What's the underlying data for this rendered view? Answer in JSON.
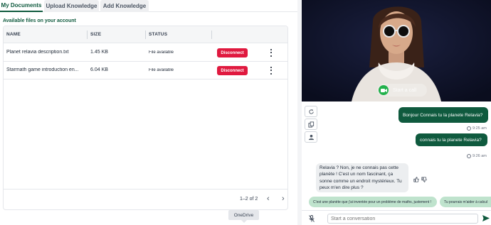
{
  "tabs": [
    {
      "label": "My Documents",
      "active": true
    },
    {
      "label": "Upload Knowledge",
      "active": false
    },
    {
      "label": "Add Knowledge",
      "active": false
    }
  ],
  "section_title": "Available files on your account",
  "table": {
    "columns": [
      "NAME",
      "SIZE",
      "STATUS"
    ],
    "rows": [
      {
        "name": "Planet relavia description.txt",
        "size": "1.45 KB",
        "status": "File available",
        "action": "Disconnect"
      },
      {
        "name": "Starmath game introduction en...",
        "size": "6.04 KB",
        "status": "File available",
        "action": "Disconnect"
      }
    ],
    "pagination": "1–2 of 2"
  },
  "tooltip": "OneDrive",
  "video": {
    "call_label": "Start a call"
  },
  "chat": {
    "messages": [
      {
        "from": "user",
        "text": "Bonjour Connais tu la planete Relavia?",
        "time": "9:25 am"
      },
      {
        "from": "user",
        "text": "connais tu la planete Relavia?",
        "time": "9:26 am"
      },
      {
        "from": "bot",
        "text": "Relavia ? Non, je ne connais pas cette planète ! C'est un nom fascinant, ça sonne comme un endroit mystérieux. Tu peux m'en dire plus ?"
      }
    ],
    "suggestions": [
      "C'est une planète que j'ai inventée pour un problème de maths, justement !",
      "Tu pourrais m'aider à calcul"
    ],
    "input_placeholder": "Start a conversation"
  },
  "colors": {
    "brand_green": "#0f5a3e",
    "danger": "#e0193f",
    "suggestion_bg": "#bfe3cd"
  }
}
